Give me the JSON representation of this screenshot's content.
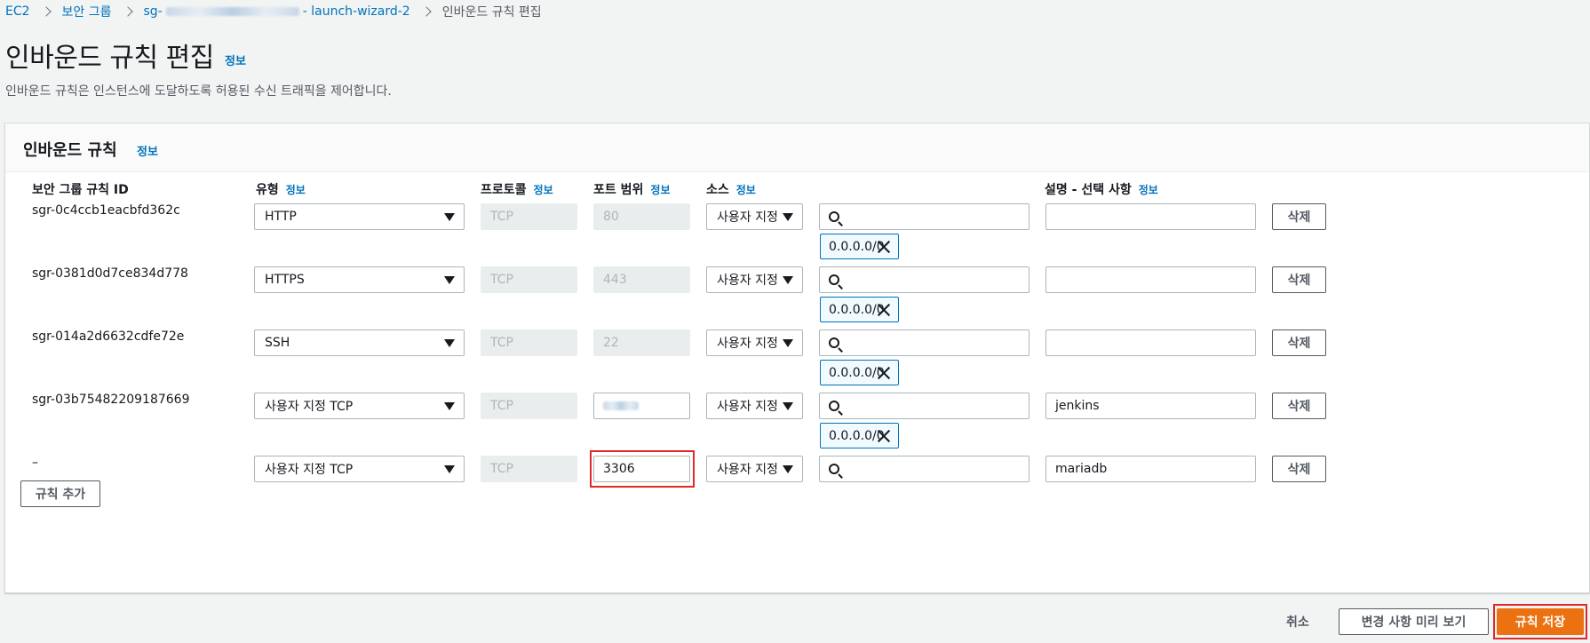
{
  "breadcrumb": {
    "items": [
      "EC2",
      "보안 그룹"
    ],
    "sg_prefix": "sg-",
    "sg_suffix": "- launch-wizard-2",
    "current": "인바운드 규칙 편집"
  },
  "page": {
    "title": "인바운드 규칙 편집",
    "info": "정보",
    "description": "인바운드 규칙은 인스턴스에 도달하도록 허용된 수신 트래픽을 제어합니다."
  },
  "panel": {
    "title": "인바운드 규칙",
    "info": "정보"
  },
  "columns": {
    "rule_id": "보안 그룹 규칙 ID",
    "type": "유형",
    "protocol": "프로토콜",
    "port_range": "포트 범위",
    "source": "소스",
    "description": "설명 - 선택 사항",
    "info": "정보"
  },
  "rules": [
    {
      "id": "sgr-0c4ccb1eacbfd362c",
      "type": "HTTP",
      "protocol": "TCP",
      "port": "80",
      "source": "사용자 지정",
      "cidr": "0.0.0.0/0",
      "description": "",
      "delete": "삭제"
    },
    {
      "id": "sgr-0381d0d7ce834d778",
      "type": "HTTPS",
      "protocol": "TCP",
      "port": "443",
      "source": "사용자 지정",
      "cidr": "0.0.0.0/0",
      "description": "",
      "delete": "삭제"
    },
    {
      "id": "sgr-014a2d6632cdfe72e",
      "type": "SSH",
      "protocol": "TCP",
      "port": "22",
      "source": "사용자 지정",
      "cidr": "0.0.0.0/0",
      "description": "",
      "delete": "삭제"
    },
    {
      "id": "sgr-03b75482209187669",
      "type": "사용자 지정 TCP",
      "protocol": "TCP",
      "port": "",
      "source": "사용자 지정",
      "cidr": "0.0.0.0/0",
      "description": "jenkins",
      "delete": "삭제"
    },
    {
      "id": "–",
      "type": "사용자 지정 TCP",
      "protocol": "TCP",
      "port": "3306",
      "source": "사용자 지정",
      "cidr": "",
      "description": "mariadb",
      "delete": "삭제"
    }
  ],
  "buttons": {
    "add_rule": "규칙 추가",
    "cancel": "취소",
    "preview": "변경 사항 미리 보기",
    "save": "규칙 저장"
  },
  "colors": {
    "link": "#0073bb",
    "primary": "#ec7211",
    "highlight": "#e02828"
  }
}
